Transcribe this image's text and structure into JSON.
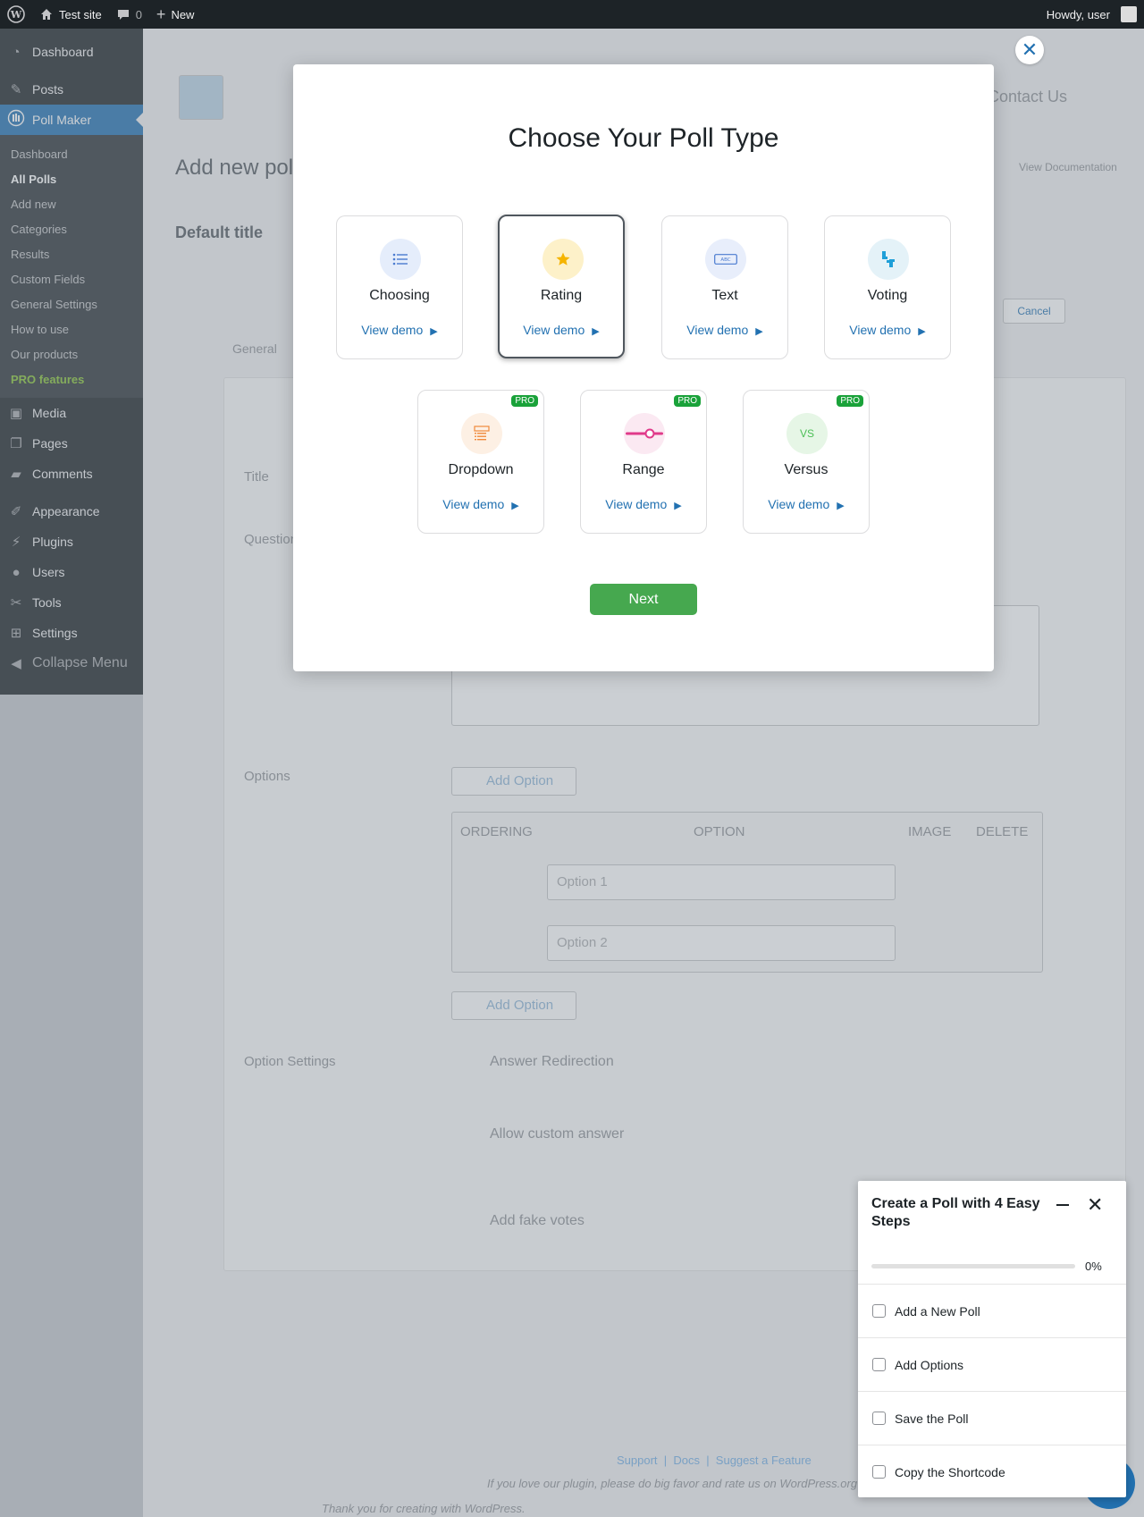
{
  "adminbar": {
    "site_name": "Test site",
    "comments_count": "0",
    "new_label": "New",
    "howdy": "Howdy, user"
  },
  "sidebar": {
    "items_top": [
      {
        "label": "Dashboard",
        "icon": "dashboard-icon"
      },
      {
        "label": "Posts",
        "icon": "pin-icon"
      }
    ],
    "current": {
      "label": "Poll Maker",
      "icon": "poll-icon"
    },
    "submenu": [
      {
        "label": "Dashboard"
      },
      {
        "label": "All Polls"
      },
      {
        "label": "Add new"
      },
      {
        "label": "Categories"
      },
      {
        "label": "Results"
      },
      {
        "label": "Custom Fields"
      },
      {
        "label": "General Settings"
      },
      {
        "label": "How to use"
      },
      {
        "label": "Our products"
      },
      {
        "label": "PRO features"
      }
    ],
    "items_bottom": [
      {
        "label": "Media",
        "icon": "media-icon"
      },
      {
        "label": "Pages",
        "icon": "pages-icon"
      },
      {
        "label": "Comments",
        "icon": "comments-icon"
      },
      {
        "label": "Appearance",
        "icon": "appearance-icon"
      },
      {
        "label": "Plugins",
        "icon": "plugins-icon"
      },
      {
        "label": "Users",
        "icon": "users-icon"
      },
      {
        "label": "Tools",
        "icon": "tools-icon"
      },
      {
        "label": "Settings",
        "icon": "settings-icon"
      }
    ],
    "collapse": "Collapse Menu"
  },
  "background": {
    "contact": "Contact Us",
    "add_new_poll": "Add new poll",
    "default_title": "Default title",
    "tab_general": "General",
    "cancel": "Cancel",
    "view_docs": "View Documentation",
    "title_label": "Title",
    "question_label": "Question",
    "options_label": "Options",
    "add_option": "Add Option",
    "col_ordering": "ORDERING",
    "col_option": "OPTION",
    "col_image": "IMAGE",
    "col_delete": "DELETE",
    "option1_placeholder": "Option 1",
    "option2_placeholder": "Option 2",
    "option_settings": "Option Settings",
    "answer_redirection": "Answer Redirection",
    "allow_custom_answer": "Allow custom answer",
    "add_fake_votes": "Add fake votes",
    "footer_links": "Support  |  Docs  |  Suggest a Feature",
    "footer_love": "If you love our plugin, please do big favor and rate us on WordPress.org",
    "footer_thanks": "Thank you for creating with WordPress."
  },
  "modal": {
    "title": "Choose Your Poll Type",
    "cards": [
      {
        "name": "Choosing",
        "demo": "View demo",
        "pro": "",
        "icon": "list-icon",
        "bg": "#e5edfb"
      },
      {
        "name": "Rating",
        "demo": "View demo",
        "pro": "",
        "icon": "star-icon",
        "bg": "#fdf1c9"
      },
      {
        "name": "Text",
        "demo": "View demo",
        "pro": "",
        "icon": "text-field-icon",
        "bg": "#e8eefb"
      },
      {
        "name": "Voting",
        "demo": "View demo",
        "pro": "",
        "icon": "thumbs-icon",
        "bg": "#e4f2f8"
      },
      {
        "name": "Dropdown",
        "demo": "View demo",
        "pro": "PRO",
        "icon": "dropdown-icon",
        "bg": "#fdf0e4"
      },
      {
        "name": "Range",
        "demo": "View demo",
        "pro": "PRO",
        "icon": "slider-icon",
        "bg": "#fbe9f2"
      },
      {
        "name": "Versus",
        "demo": "View demo",
        "pro": "PRO",
        "icon": "versus-icon",
        "bg": "#e6f6e6"
      }
    ],
    "versus_text": "VS",
    "next": "Next"
  },
  "steps": {
    "title": "Create a Poll with 4 Easy Steps",
    "progress": 0,
    "progress_label": "0%",
    "items": [
      {
        "label": "Add a New Poll"
      },
      {
        "label": "Add Options"
      },
      {
        "label": "Save the Poll"
      },
      {
        "label": "Copy the Shortcode"
      }
    ]
  }
}
